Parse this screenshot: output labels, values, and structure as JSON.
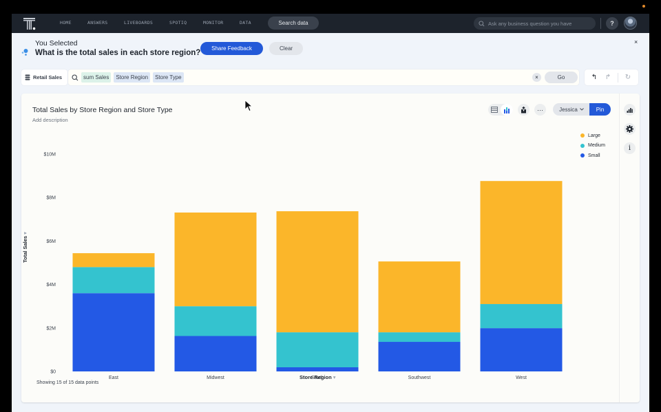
{
  "nav": {
    "items": [
      "HOME",
      "ANSWERS",
      "LIVEBOARDS",
      "SPOTIQ",
      "MONITOR",
      "DATA"
    ],
    "search_data_label": "Search data",
    "ask_placeholder": "Ask any business question you have",
    "help_label": "?"
  },
  "banner": {
    "heading": "You Selected",
    "question": "What is the total sales in each store region?",
    "share_feedback_label": "Share Feedback",
    "clear_label": "Clear",
    "close_label": "×"
  },
  "search": {
    "datasource_label": "Retail Sales",
    "tokens": [
      {
        "text": "sum Sales",
        "kind": "measure"
      },
      {
        "text": "Store Region",
        "kind": "attribute"
      },
      {
        "text": "Store Type",
        "kind": "attribute"
      }
    ],
    "clear_label": "×",
    "go_label": "Go"
  },
  "history": {
    "undo": "↰",
    "redo": "↱",
    "reset": "↻"
  },
  "card": {
    "title": "Total Sales by Store Region and Store Type",
    "description_placeholder": "Add description",
    "owner": "Jessica",
    "pin_label": "Pin",
    "more_label": "···",
    "data_points_text": "Showing 15 of 15 data points"
  },
  "colors": {
    "accent": "#2359d8",
    "large": "#fbb62a",
    "medium": "#34c3cf",
    "small": "#2359e5",
    "nav_bg": "#1d232c"
  },
  "chart_data": {
    "type": "bar",
    "stacked": true,
    "title": "Total Sales by Store Region and Store Type",
    "xlabel": "Store Region",
    "ylabel": "Total Sales",
    "categories": [
      "East",
      "Midwest",
      "South",
      "Southwest",
      "West"
    ],
    "series": [
      {
        "name": "Small",
        "color": "#2359e5",
        "values": [
          3.6,
          1.63,
          0.19,
          1.36,
          1.99
        ]
      },
      {
        "name": "Medium",
        "color": "#34c3cf",
        "values": [
          1.2,
          1.37,
          1.61,
          0.44,
          1.11
        ]
      },
      {
        "name": "Large",
        "color": "#fbb62a",
        "values": [
          0.64,
          4.31,
          5.57,
          3.26,
          5.66
        ]
      }
    ],
    "legend_order": [
      "Large",
      "Medium",
      "Small"
    ],
    "legend_position": "top-right",
    "ylim": [
      0,
      10
    ],
    "yticks": [
      0,
      2,
      4,
      6,
      8,
      10
    ],
    "ytick_labels": [
      "$0",
      "$2M",
      "$4M",
      "$6M",
      "$8M",
      "$10M"
    ],
    "units": "millions USD",
    "grid": false
  }
}
